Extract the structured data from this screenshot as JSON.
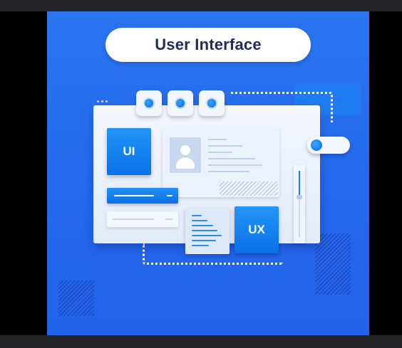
{
  "title": "User Interface",
  "cards": {
    "ui_label": "UI",
    "ux_label": "UX"
  },
  "icons": [
    "avatar-icon",
    "toggle-icon",
    "slider-icon",
    "document-icon"
  ],
  "colors": {
    "background": "#2468ee",
    "accent": "#0b6fe6",
    "card": "#ecf2fb",
    "title_text": "#1b2e5c"
  }
}
